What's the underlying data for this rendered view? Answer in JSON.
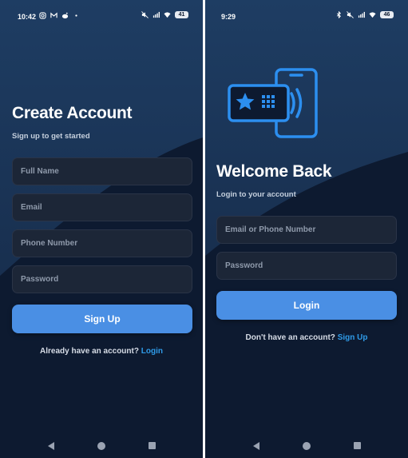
{
  "signup_screen": {
    "status_bar": {
      "time": "10:42",
      "left_icons": [
        "instagram-icon",
        "gmail-icon",
        "reddit-icon",
        "dot-icon"
      ],
      "right_icons": [
        "mute-icon",
        "signal-icon",
        "wifi-icon"
      ],
      "battery": "41"
    },
    "title": "Create Account",
    "subtitle": "Sign up to get started",
    "fields": {
      "full_name_placeholder": "Full Name",
      "email_placeholder": "Email",
      "phone_placeholder": "Phone Number",
      "password_placeholder": "Password"
    },
    "button_label": "Sign Up",
    "footer": {
      "prompt": "Already have an account?",
      "link": "Login"
    }
  },
  "login_screen": {
    "status_bar": {
      "time": "9:29",
      "right_icons": [
        "bluetooth-icon",
        "mute-icon",
        "signal-icon",
        "wifi-icon"
      ],
      "battery": "46"
    },
    "illustration": "nfc-card-phone-icon",
    "title": "Welcome Back",
    "subtitle": "Login to your account",
    "fields": {
      "identifier_placeholder": "Email or Phone Number",
      "password_placeholder": "Password"
    },
    "button_label": "Login",
    "footer": {
      "prompt": "Don't have an account?",
      "link": "Sign Up"
    }
  },
  "colors": {
    "background_dark": "#0d1a30",
    "background_light": "#1f3a5f",
    "field_background": "#1c2637",
    "accent_button": "#4a8fe4",
    "link": "#2f9be8",
    "illustration": "#2c8ff0"
  },
  "nav_bar_icons": [
    "back-icon",
    "home-icon",
    "recents-icon"
  ]
}
